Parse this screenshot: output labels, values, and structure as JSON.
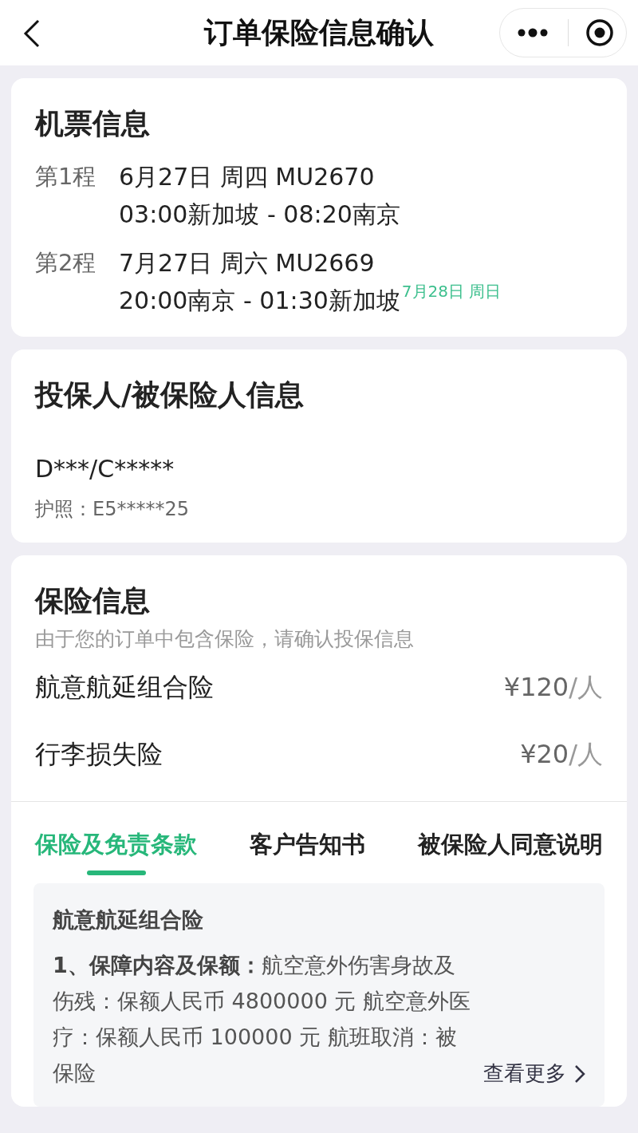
{
  "nav": {
    "title": "订单保险信息确认"
  },
  "flight_card": {
    "title": "机票信息",
    "legs": [
      {
        "label": "第1程",
        "line1": "6月27日 周四 MU2670",
        "line2": "03:00新加坡 - 08:20南京"
      },
      {
        "label": "第2程",
        "line1": "7月27日 周六 MU2669",
        "line2": "20:00南京 - 01:30新加坡",
        "arrival_note": "7月28日 周日"
      }
    ]
  },
  "insured_card": {
    "title": "投保人/被保险人信息",
    "name": "D***/C*****",
    "passport": "护照：E5*****25"
  },
  "insurance_card": {
    "title": "保险信息",
    "subtitle": "由于您的订单中包含保险，请确认投保信息",
    "products": [
      {
        "name": "航意航延组合险",
        "price": "¥120",
        "unit": "/人"
      },
      {
        "name": "行李损失险",
        "price": "¥20",
        "unit": "/人"
      }
    ],
    "tabs": [
      {
        "label": "保险及免责条款",
        "selected": true
      },
      {
        "label": "客户告知书",
        "selected": false
      },
      {
        "label": "被保险人同意说明",
        "selected": false
      }
    ],
    "clause": {
      "title": "航意航延组合险",
      "text": "**1、保障内容及保额：**航空意外伤害身故及伤残：保额人民币 4800000 元 航空意外医疗：保额人民币 100000 元 航班取消：被保险",
      "more": "查看更多"
    }
  }
}
